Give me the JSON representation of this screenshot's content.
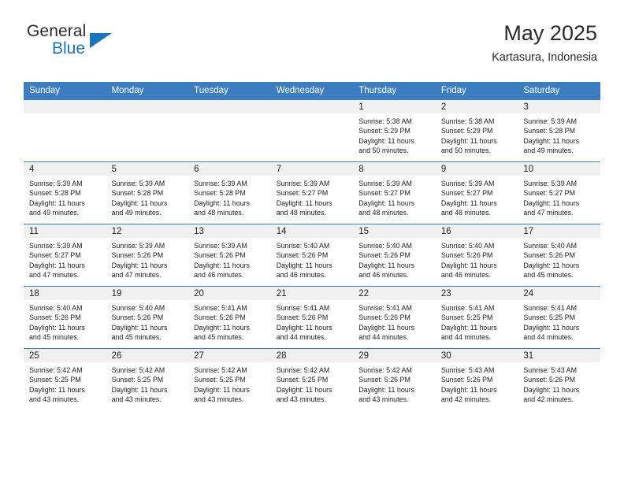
{
  "logo": {
    "word_one": "General",
    "word_two": "Blue",
    "icon": "triangle-icon",
    "brand_color": "#1b75bb"
  },
  "header": {
    "title": "May 2025",
    "subtitle": "Kartasura, Indonesia"
  },
  "theme": {
    "header_row_bg": "#3b7dc0",
    "daynum_band_bg": "#f0f0f0",
    "grid_line": "#3b7dc0"
  },
  "weekday_headers": [
    "Sunday",
    "Monday",
    "Tuesday",
    "Wednesday",
    "Thursday",
    "Friday",
    "Saturday"
  ],
  "weeks": [
    [
      {
        "day": "",
        "empty": true
      },
      {
        "day": "",
        "empty": true
      },
      {
        "day": "",
        "empty": true
      },
      {
        "day": "",
        "empty": true
      },
      {
        "day": "1",
        "sunrise": "Sunrise: 5:38 AM",
        "sunset": "Sunset: 5:29 PM",
        "daylight_line1": "Daylight: 11 hours",
        "daylight_line2": "and 50 minutes."
      },
      {
        "day": "2",
        "sunrise": "Sunrise: 5:38 AM",
        "sunset": "Sunset: 5:29 PM",
        "daylight_line1": "Daylight: 11 hours",
        "daylight_line2": "and 50 minutes."
      },
      {
        "day": "3",
        "sunrise": "Sunrise: 5:39 AM",
        "sunset": "Sunset: 5:28 PM",
        "daylight_line1": "Daylight: 11 hours",
        "daylight_line2": "and 49 minutes."
      }
    ],
    [
      {
        "day": "4",
        "sunrise": "Sunrise: 5:39 AM",
        "sunset": "Sunset: 5:28 PM",
        "daylight_line1": "Daylight: 11 hours",
        "daylight_line2": "and 49 minutes."
      },
      {
        "day": "5",
        "sunrise": "Sunrise: 5:39 AM",
        "sunset": "Sunset: 5:28 PM",
        "daylight_line1": "Daylight: 11 hours",
        "daylight_line2": "and 49 minutes."
      },
      {
        "day": "6",
        "sunrise": "Sunrise: 5:39 AM",
        "sunset": "Sunset: 5:28 PM",
        "daylight_line1": "Daylight: 11 hours",
        "daylight_line2": "and 48 minutes."
      },
      {
        "day": "7",
        "sunrise": "Sunrise: 5:39 AM",
        "sunset": "Sunset: 5:27 PM",
        "daylight_line1": "Daylight: 11 hours",
        "daylight_line2": "and 48 minutes."
      },
      {
        "day": "8",
        "sunrise": "Sunrise: 5:39 AM",
        "sunset": "Sunset: 5:27 PM",
        "daylight_line1": "Daylight: 11 hours",
        "daylight_line2": "and 48 minutes."
      },
      {
        "day": "9",
        "sunrise": "Sunrise: 5:39 AM",
        "sunset": "Sunset: 5:27 PM",
        "daylight_line1": "Daylight: 11 hours",
        "daylight_line2": "and 48 minutes."
      },
      {
        "day": "10",
        "sunrise": "Sunrise: 5:39 AM",
        "sunset": "Sunset: 5:27 PM",
        "daylight_line1": "Daylight: 11 hours",
        "daylight_line2": "and 47 minutes."
      }
    ],
    [
      {
        "day": "11",
        "sunrise": "Sunrise: 5:39 AM",
        "sunset": "Sunset: 5:27 PM",
        "daylight_line1": "Daylight: 11 hours",
        "daylight_line2": "and 47 minutes."
      },
      {
        "day": "12",
        "sunrise": "Sunrise: 5:39 AM",
        "sunset": "Sunset: 5:26 PM",
        "daylight_line1": "Daylight: 11 hours",
        "daylight_line2": "and 47 minutes."
      },
      {
        "day": "13",
        "sunrise": "Sunrise: 5:39 AM",
        "sunset": "Sunset: 5:26 PM",
        "daylight_line1": "Daylight: 11 hours",
        "daylight_line2": "and 46 minutes."
      },
      {
        "day": "14",
        "sunrise": "Sunrise: 5:40 AM",
        "sunset": "Sunset: 5:26 PM",
        "daylight_line1": "Daylight: 11 hours",
        "daylight_line2": "and 46 minutes."
      },
      {
        "day": "15",
        "sunrise": "Sunrise: 5:40 AM",
        "sunset": "Sunset: 5:26 PM",
        "daylight_line1": "Daylight: 11 hours",
        "daylight_line2": "and 46 minutes."
      },
      {
        "day": "16",
        "sunrise": "Sunrise: 5:40 AM",
        "sunset": "Sunset: 5:26 PM",
        "daylight_line1": "Daylight: 11 hours",
        "daylight_line2": "and 46 minutes."
      },
      {
        "day": "17",
        "sunrise": "Sunrise: 5:40 AM",
        "sunset": "Sunset: 5:26 PM",
        "daylight_line1": "Daylight: 11 hours",
        "daylight_line2": "and 45 minutes."
      }
    ],
    [
      {
        "day": "18",
        "sunrise": "Sunrise: 5:40 AM",
        "sunset": "Sunset: 5:26 PM",
        "daylight_line1": "Daylight: 11 hours",
        "daylight_line2": "and 45 minutes."
      },
      {
        "day": "19",
        "sunrise": "Sunrise: 5:40 AM",
        "sunset": "Sunset: 5:26 PM",
        "daylight_line1": "Daylight: 11 hours",
        "daylight_line2": "and 45 minutes."
      },
      {
        "day": "20",
        "sunrise": "Sunrise: 5:41 AM",
        "sunset": "Sunset: 5:26 PM",
        "daylight_line1": "Daylight: 11 hours",
        "daylight_line2": "and 45 minutes."
      },
      {
        "day": "21",
        "sunrise": "Sunrise: 5:41 AM",
        "sunset": "Sunset: 5:26 PM",
        "daylight_line1": "Daylight: 11 hours",
        "daylight_line2": "and 44 minutes."
      },
      {
        "day": "22",
        "sunrise": "Sunrise: 5:41 AM",
        "sunset": "Sunset: 5:26 PM",
        "daylight_line1": "Daylight: 11 hours",
        "daylight_line2": "and 44 minutes."
      },
      {
        "day": "23",
        "sunrise": "Sunrise: 5:41 AM",
        "sunset": "Sunset: 5:25 PM",
        "daylight_line1": "Daylight: 11 hours",
        "daylight_line2": "and 44 minutes."
      },
      {
        "day": "24",
        "sunrise": "Sunrise: 5:41 AM",
        "sunset": "Sunset: 5:25 PM",
        "daylight_line1": "Daylight: 11 hours",
        "daylight_line2": "and 44 minutes."
      }
    ],
    [
      {
        "day": "25",
        "sunrise": "Sunrise: 5:42 AM",
        "sunset": "Sunset: 5:25 PM",
        "daylight_line1": "Daylight: 11 hours",
        "daylight_line2": "and 43 minutes."
      },
      {
        "day": "26",
        "sunrise": "Sunrise: 5:42 AM",
        "sunset": "Sunset: 5:25 PM",
        "daylight_line1": "Daylight: 11 hours",
        "daylight_line2": "and 43 minutes."
      },
      {
        "day": "27",
        "sunrise": "Sunrise: 5:42 AM",
        "sunset": "Sunset: 5:25 PM",
        "daylight_line1": "Daylight: 11 hours",
        "daylight_line2": "and 43 minutes."
      },
      {
        "day": "28",
        "sunrise": "Sunrise: 5:42 AM",
        "sunset": "Sunset: 5:25 PM",
        "daylight_line1": "Daylight: 11 hours",
        "daylight_line2": "and 43 minutes."
      },
      {
        "day": "29",
        "sunrise": "Sunrise: 5:42 AM",
        "sunset": "Sunset: 5:26 PM",
        "daylight_line1": "Daylight: 11 hours",
        "daylight_line2": "and 43 minutes."
      },
      {
        "day": "30",
        "sunrise": "Sunrise: 5:43 AM",
        "sunset": "Sunset: 5:26 PM",
        "daylight_line1": "Daylight: 11 hours",
        "daylight_line2": "and 42 minutes."
      },
      {
        "day": "31",
        "sunrise": "Sunrise: 5:43 AM",
        "sunset": "Sunset: 5:26 PM",
        "daylight_line1": "Daylight: 11 hours",
        "daylight_line2": "and 42 minutes."
      }
    ]
  ]
}
